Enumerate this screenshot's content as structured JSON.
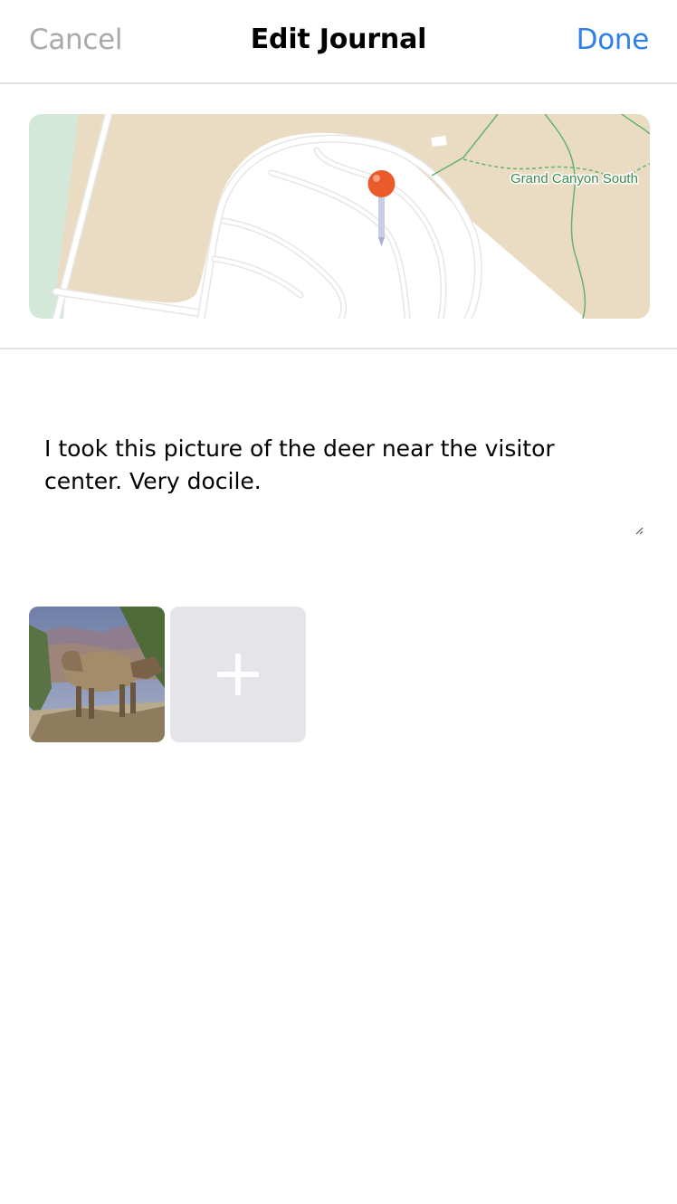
{
  "nav": {
    "cancel_label": "Cancel",
    "title": "Edit Journal",
    "done_label": "Done"
  },
  "map": {
    "place_label": "Grand Canyon South",
    "pin_icon": "map-pin-icon",
    "colors": {
      "land": "#e9dcc3",
      "water": "#d3e8d9",
      "road": "#ffffff",
      "road_outline": "#e6e6e6",
      "trail": "#66b26e",
      "pin_head": "#ea5a2a",
      "pin_needle": "#c7cde6"
    }
  },
  "journal": {
    "note_text": "I took this picture of the deer near the visitor center. Very docile."
  },
  "photos": {
    "items": [
      {
        "subject": "elk-photo"
      }
    ],
    "add_icon": "plus-icon"
  },
  "colors": {
    "accent": "#2f80e8",
    "cancel": "#a8a8ad",
    "divider": "#e2e2e4",
    "add_tile": "#e4e4e9"
  }
}
